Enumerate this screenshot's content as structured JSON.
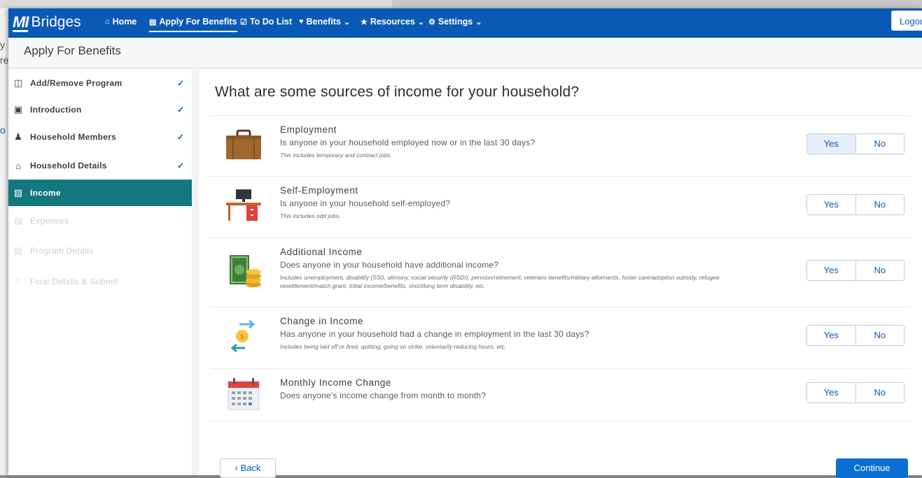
{
  "background": {
    "fragments": [
      "y",
      "re",
      "o"
    ]
  },
  "brand": {
    "mark": "MI",
    "name": "Bridges"
  },
  "nav": [
    {
      "label": "Home",
      "icon": "home-icon"
    },
    {
      "label": "Apply For Benefits",
      "icon": "document-icon",
      "active": true
    },
    {
      "label": "To Do List",
      "icon": "checkbox-icon"
    },
    {
      "label": "Benefits",
      "icon": "heart-icon",
      "dropdown": true
    },
    {
      "label": "Resources",
      "icon": "star-icon",
      "dropdown": true
    },
    {
      "label": "Settings",
      "icon": "gear-icon",
      "dropdown": true
    }
  ],
  "logout": {
    "label": "Logout"
  },
  "page": {
    "title": "Apply For Benefits"
  },
  "steps": [
    {
      "label": "Add/Remove Program",
      "icon": "add-remove-icon",
      "state": "complete"
    },
    {
      "label": "Introduction",
      "icon": "id-card-icon",
      "state": "complete"
    },
    {
      "label": "Household Members",
      "icon": "people-icon",
      "state": "complete"
    },
    {
      "label": "Household Details",
      "icon": "house-icon",
      "state": "complete"
    },
    {
      "label": "Income",
      "icon": "wallet-icon",
      "state": "active"
    },
    {
      "label": "Expenses",
      "icon": "receipt-icon",
      "state": "disabled"
    },
    {
      "label": "Program Details",
      "icon": "document-icon",
      "state": "disabled"
    },
    {
      "label": "Final Details & Submit",
      "icon": "flag-icon",
      "state": "disabled"
    }
  ],
  "question": {
    "title": "What are some sources of income for your household?"
  },
  "income_sources": [
    {
      "title": "Employment",
      "question": "Is anyone in your household employed now or in the last 30 days?",
      "note": "This includes temporary and contract jobs.",
      "icon": "briefcase-icon",
      "selected": "Yes"
    },
    {
      "title": "Self-Employment",
      "question": "Is anyone in your household self-employed?",
      "note": "This includes odd jobs.",
      "icon": "desk-icon",
      "selected": null
    },
    {
      "title": "Additional Income",
      "question": "Does anyone in your household have additional income?",
      "note": "Includes unemployment, disability (SSI), alimony, social security (RSDI), pension/retirement, veterans benefits/military allotments, foster care/adoption subsidy, refugee resettlement/match grant, tribal income/benefits, short/long term disability, etc.",
      "icon": "money-icon",
      "selected": null
    },
    {
      "title": "Change in Income",
      "question": "Has anyone in your household had a change in employment in the last 30 days?",
      "note": "Includes being laid off or fired, quitting, going on strike, voluntarily reducing hours, etc.",
      "icon": "exchange-icon",
      "selected": null
    },
    {
      "title": "Monthly Income Change",
      "question": "Does anyone's income change from month to month?",
      "note": "",
      "icon": "calendar-icon",
      "selected": null
    }
  ],
  "options": {
    "yes": "Yes",
    "no": "No"
  },
  "actions": {
    "back": "Back",
    "continue": "Continue"
  },
  "colors": {
    "topbar": "#0a5ab5",
    "active_step": "#13777e",
    "primary": "#0a6fd1"
  }
}
